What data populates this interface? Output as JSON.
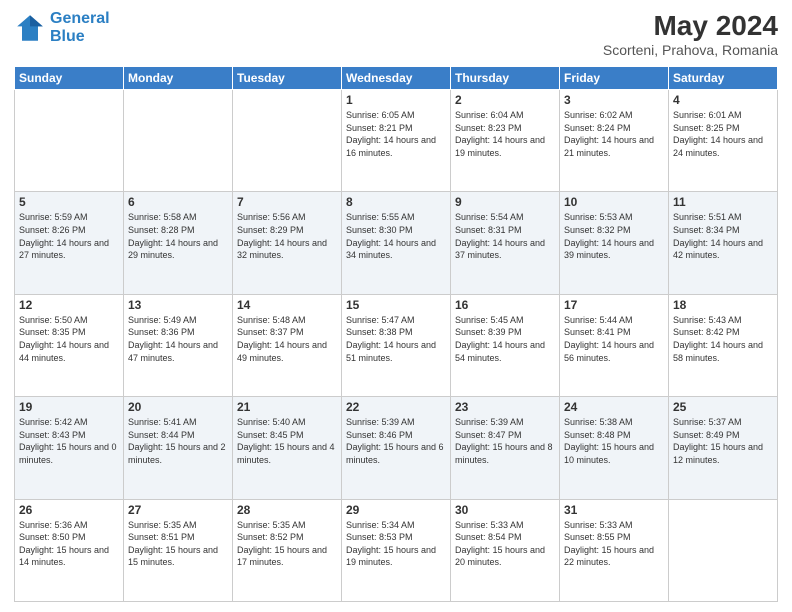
{
  "header": {
    "logo_line1": "General",
    "logo_line2": "Blue",
    "month_year": "May 2024",
    "location": "Scorteni, Prahova, Romania"
  },
  "weekdays": [
    "Sunday",
    "Monday",
    "Tuesday",
    "Wednesday",
    "Thursday",
    "Friday",
    "Saturday"
  ],
  "weeks": [
    [
      {
        "day": "",
        "info": ""
      },
      {
        "day": "",
        "info": ""
      },
      {
        "day": "",
        "info": ""
      },
      {
        "day": "1",
        "info": "Sunrise: 6:05 AM\nSunset: 8:21 PM\nDaylight: 14 hours\nand 16 minutes."
      },
      {
        "day": "2",
        "info": "Sunrise: 6:04 AM\nSunset: 8:23 PM\nDaylight: 14 hours\nand 19 minutes."
      },
      {
        "day": "3",
        "info": "Sunrise: 6:02 AM\nSunset: 8:24 PM\nDaylight: 14 hours\nand 21 minutes."
      },
      {
        "day": "4",
        "info": "Sunrise: 6:01 AM\nSunset: 8:25 PM\nDaylight: 14 hours\nand 24 minutes."
      }
    ],
    [
      {
        "day": "5",
        "info": "Sunrise: 5:59 AM\nSunset: 8:26 PM\nDaylight: 14 hours\nand 27 minutes."
      },
      {
        "day": "6",
        "info": "Sunrise: 5:58 AM\nSunset: 8:28 PM\nDaylight: 14 hours\nand 29 minutes."
      },
      {
        "day": "7",
        "info": "Sunrise: 5:56 AM\nSunset: 8:29 PM\nDaylight: 14 hours\nand 32 minutes."
      },
      {
        "day": "8",
        "info": "Sunrise: 5:55 AM\nSunset: 8:30 PM\nDaylight: 14 hours\nand 34 minutes."
      },
      {
        "day": "9",
        "info": "Sunrise: 5:54 AM\nSunset: 8:31 PM\nDaylight: 14 hours\nand 37 minutes."
      },
      {
        "day": "10",
        "info": "Sunrise: 5:53 AM\nSunset: 8:32 PM\nDaylight: 14 hours\nand 39 minutes."
      },
      {
        "day": "11",
        "info": "Sunrise: 5:51 AM\nSunset: 8:34 PM\nDaylight: 14 hours\nand 42 minutes."
      }
    ],
    [
      {
        "day": "12",
        "info": "Sunrise: 5:50 AM\nSunset: 8:35 PM\nDaylight: 14 hours\nand 44 minutes."
      },
      {
        "day": "13",
        "info": "Sunrise: 5:49 AM\nSunset: 8:36 PM\nDaylight: 14 hours\nand 47 minutes."
      },
      {
        "day": "14",
        "info": "Sunrise: 5:48 AM\nSunset: 8:37 PM\nDaylight: 14 hours\nand 49 minutes."
      },
      {
        "day": "15",
        "info": "Sunrise: 5:47 AM\nSunset: 8:38 PM\nDaylight: 14 hours\nand 51 minutes."
      },
      {
        "day": "16",
        "info": "Sunrise: 5:45 AM\nSunset: 8:39 PM\nDaylight: 14 hours\nand 54 minutes."
      },
      {
        "day": "17",
        "info": "Sunrise: 5:44 AM\nSunset: 8:41 PM\nDaylight: 14 hours\nand 56 minutes."
      },
      {
        "day": "18",
        "info": "Sunrise: 5:43 AM\nSunset: 8:42 PM\nDaylight: 14 hours\nand 58 minutes."
      }
    ],
    [
      {
        "day": "19",
        "info": "Sunrise: 5:42 AM\nSunset: 8:43 PM\nDaylight: 15 hours\nand 0 minutes."
      },
      {
        "day": "20",
        "info": "Sunrise: 5:41 AM\nSunset: 8:44 PM\nDaylight: 15 hours\nand 2 minutes."
      },
      {
        "day": "21",
        "info": "Sunrise: 5:40 AM\nSunset: 8:45 PM\nDaylight: 15 hours\nand 4 minutes."
      },
      {
        "day": "22",
        "info": "Sunrise: 5:39 AM\nSunset: 8:46 PM\nDaylight: 15 hours\nand 6 minutes."
      },
      {
        "day": "23",
        "info": "Sunrise: 5:39 AM\nSunset: 8:47 PM\nDaylight: 15 hours\nand 8 minutes."
      },
      {
        "day": "24",
        "info": "Sunrise: 5:38 AM\nSunset: 8:48 PM\nDaylight: 15 hours\nand 10 minutes."
      },
      {
        "day": "25",
        "info": "Sunrise: 5:37 AM\nSunset: 8:49 PM\nDaylight: 15 hours\nand 12 minutes."
      }
    ],
    [
      {
        "day": "26",
        "info": "Sunrise: 5:36 AM\nSunset: 8:50 PM\nDaylight: 15 hours\nand 14 minutes."
      },
      {
        "day": "27",
        "info": "Sunrise: 5:35 AM\nSunset: 8:51 PM\nDaylight: 15 hours\nand 15 minutes."
      },
      {
        "day": "28",
        "info": "Sunrise: 5:35 AM\nSunset: 8:52 PM\nDaylight: 15 hours\nand 17 minutes."
      },
      {
        "day": "29",
        "info": "Sunrise: 5:34 AM\nSunset: 8:53 PM\nDaylight: 15 hours\nand 19 minutes."
      },
      {
        "day": "30",
        "info": "Sunrise: 5:33 AM\nSunset: 8:54 PM\nDaylight: 15 hours\nand 20 minutes."
      },
      {
        "day": "31",
        "info": "Sunrise: 5:33 AM\nSunset: 8:55 PM\nDaylight: 15 hours\nand 22 minutes."
      },
      {
        "day": "",
        "info": ""
      }
    ]
  ]
}
